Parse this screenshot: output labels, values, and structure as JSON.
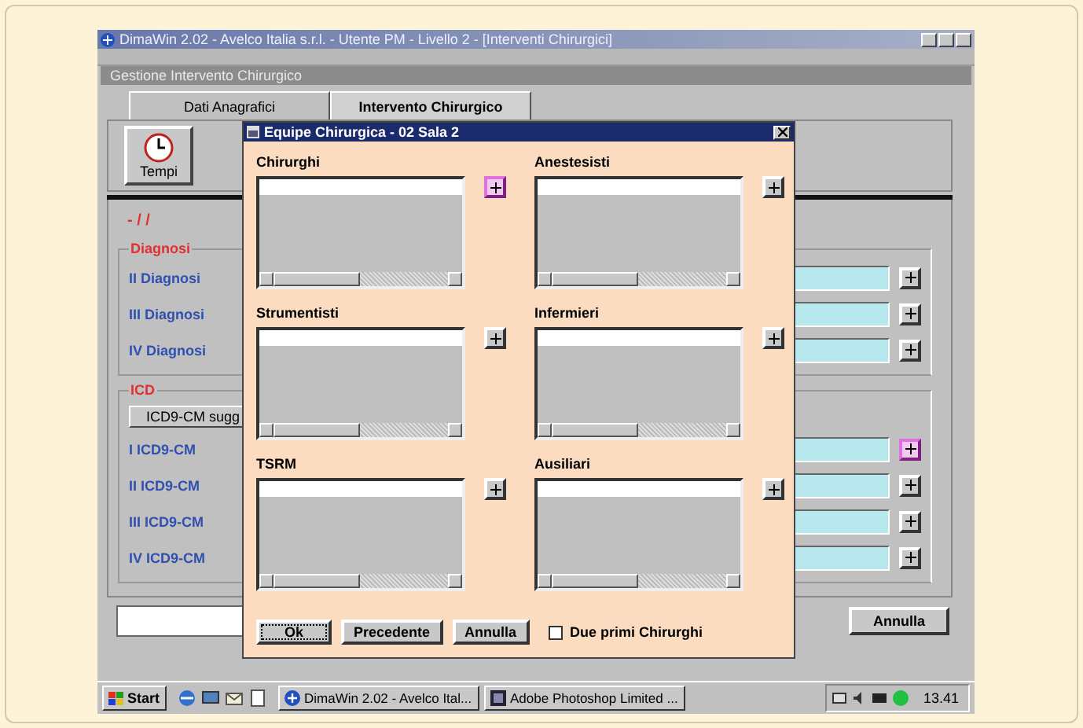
{
  "window": {
    "title": "DimaWin 2.02 - Avelco Italia s.r.l. - Utente PM - Livello 2 - [Interventi Chirurgici]"
  },
  "child_window": {
    "title": "Gestione Intervento Chirurgico"
  },
  "tabs": [
    {
      "label": "Dati Anagrafici",
      "selected": false
    },
    {
      "label": "Intervento Chirurgico",
      "selected": true
    }
  ],
  "toolbar": [
    {
      "label": "Tempi"
    }
  ],
  "date_text": "-  /  /",
  "groups": [
    {
      "title": "Diagnosi",
      "rows": [
        {
          "label": "II Diagnosi",
          "focused": false
        },
        {
          "label": "III Diagnosi",
          "focused": false
        },
        {
          "label": "IV Diagnosi",
          "focused": false
        }
      ]
    },
    {
      "title": "ICD",
      "button": "ICD9-CM sugg",
      "rows": [
        {
          "label": "I ICD9-CM",
          "focused": true
        },
        {
          "label": "II ICD9-CM",
          "focused": false
        },
        {
          "label": "III ICD9-CM",
          "focused": false
        },
        {
          "label": "IV ICD9-CM",
          "focused": false
        }
      ]
    }
  ],
  "buttons": [
    {
      "label": "Annulla"
    }
  ],
  "dialog": {
    "title": "Equipe Chirurgica - 02 Sala  2",
    "lists": [
      {
        "label": "Chirurghi",
        "focused": true
      },
      {
        "label": "Anestesisti",
        "focused": false
      },
      {
        "label": "Strumentisti",
        "focused": false
      },
      {
        "label": "Infermieri",
        "focused": false
      },
      {
        "label": "TSRM",
        "focused": false
      },
      {
        "label": "Ausiliari",
        "focused": false
      }
    ],
    "buttons": [
      {
        "label": "Ok",
        "focused": true
      },
      {
        "label": "Precedente",
        "focused": false
      },
      {
        "label": "Annulla",
        "focused": false
      }
    ],
    "checkbox": {
      "label": "Due primi Chirurghi",
      "checked": false
    }
  },
  "taskbar": {
    "start": "Start",
    "tasks": [
      {
        "label": "DimaWin 2.02 - Avelco Ital..."
      },
      {
        "label": "Adobe Photoshop Limited ..."
      }
    ],
    "clock": "13.41"
  }
}
